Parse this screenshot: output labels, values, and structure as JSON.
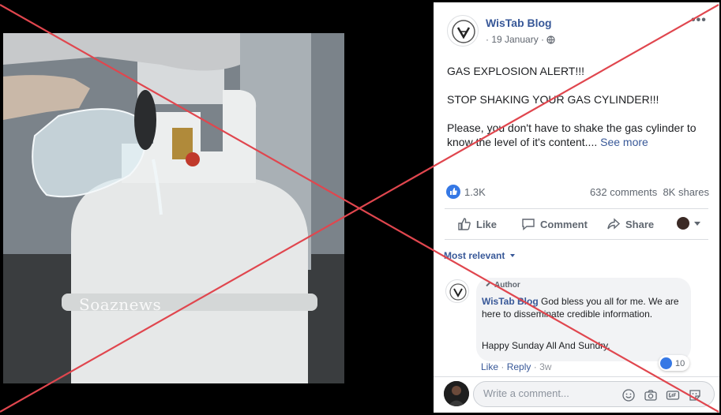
{
  "image": {
    "watermark": "Soaznews"
  },
  "post": {
    "page_name": "WisTab Blog",
    "date": "· 19 January ·",
    "more_menu": "•••",
    "text_line1": "GAS EXPLOSION ALERT!!!",
    "text_line2": "STOP SHAKING YOUR GAS CYLINDER!!!",
    "text_line3": "Please, you don't have to shake the gas cylinder to know the level of it's content....",
    "see_more": "See more",
    "reaction_count": "1.3K",
    "comments_count": "632 comments",
    "shares_count": "8K shares"
  },
  "actions": {
    "like": "Like",
    "comment": "Comment",
    "share": "Share"
  },
  "comments": {
    "sort_label": "Most relevant",
    "author_tag": "Author",
    "author_name": "WisTab Blog",
    "text": "God bless you all for me. We are here to disseminate credible information.",
    "text2": "Happy Sunday All And Sundry.",
    "reaction_count": "10",
    "like_link": "Like",
    "reply_link": "Reply",
    "age": "3w",
    "composer_placeholder": "Write a comment..."
  },
  "colors": {
    "link": "#385898",
    "like_blue": "#3578e5",
    "cross_red": "#e0464e"
  }
}
